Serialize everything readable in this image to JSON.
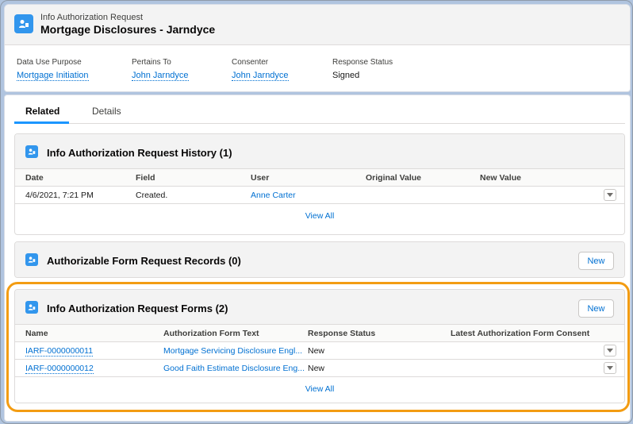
{
  "record": {
    "object_type": "Info Authorization Request",
    "title": "Mortgage Disclosures - Jarndyce"
  },
  "fields": [
    {
      "label": "Data Use Purpose",
      "value": "Mortgage Initiation"
    },
    {
      "label": "Pertains To",
      "value": "John Jarndyce"
    },
    {
      "label": "Consenter",
      "value": "John Jarndyce"
    },
    {
      "label": "Response Status",
      "value": "Signed"
    }
  ],
  "tabs": {
    "related": "Related",
    "details": "Details"
  },
  "history": {
    "title": "Info Authorization Request History (1)",
    "columns": [
      "Date",
      "Field",
      "User",
      "Original Value",
      "New Value"
    ],
    "rows": [
      {
        "date": "4/6/2021, 7:21 PM",
        "field": "Created.",
        "user": "Anne Carter",
        "original": "",
        "new": ""
      }
    ],
    "view_all": "View All"
  },
  "form_requests": {
    "title": "Authorizable Form Request Records (0)",
    "new_label": "New"
  },
  "forms": {
    "title": "Info Authorization Request Forms (2)",
    "new_label": "New",
    "columns": [
      "Name",
      "Authorization Form Text",
      "Response Status",
      "Latest Authorization Form Consent"
    ],
    "rows": [
      {
        "name": "IARF-0000000011",
        "text": "Mortgage Servicing Disclosure Engl...",
        "status": "New",
        "consent": ""
      },
      {
        "name": "IARF-0000000012",
        "text": "Good Faith Estimate Disclosure Eng...",
        "status": "New",
        "consent": ""
      }
    ],
    "view_all": "View All"
  },
  "colors": {
    "accent": "#0070d2",
    "icon": "#3296ed",
    "highlight": "#f39c12"
  }
}
